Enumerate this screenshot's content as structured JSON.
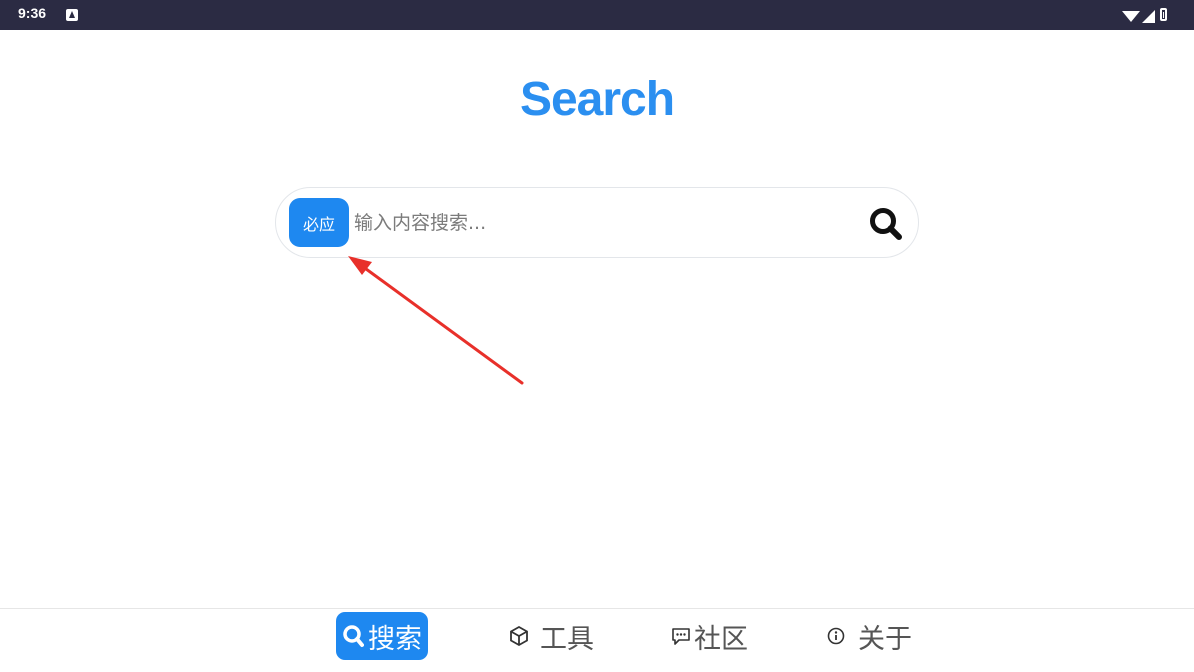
{
  "status_bar": {
    "time": "9:36"
  },
  "app": {
    "title": "Search"
  },
  "search": {
    "engine_label": "必应",
    "placeholder": "输入内容搜索...",
    "value": ""
  },
  "nav": [
    {
      "label": "搜索",
      "icon": "search-icon",
      "active": true
    },
    {
      "label": "工具",
      "icon": "cube-icon",
      "active": false
    },
    {
      "label": "社区",
      "icon": "chat-icon",
      "active": false
    },
    {
      "label": "关于",
      "icon": "info-icon",
      "active": false
    }
  ],
  "colors": {
    "accent": "#1e88f0",
    "title": "#2b8ff0",
    "status_bar": "#2b2b43",
    "annotation_arrow": "#e8302a"
  }
}
